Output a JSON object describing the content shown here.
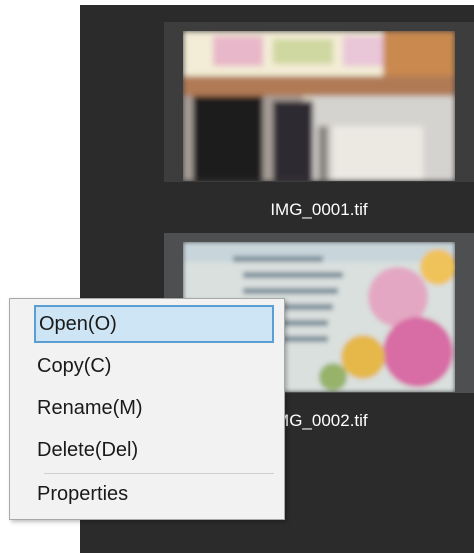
{
  "gallery": {
    "items": [
      {
        "filename": "IMG_0001.tif"
      },
      {
        "filename": "IMG_0002.tif"
      }
    ]
  },
  "context_menu": {
    "items": [
      {
        "label": "Open(O)"
      },
      {
        "label": "Copy(C)"
      },
      {
        "label": "Rename(M)"
      },
      {
        "label": "Delete(Del)"
      },
      {
        "label": "Properties"
      }
    ]
  },
  "colors": {
    "viewer_bg": "#2b2b2b",
    "menu_bg": "#f2f2f2",
    "menu_highlight": "#cde5f5",
    "menu_highlight_border": "#5a9fd4"
  }
}
